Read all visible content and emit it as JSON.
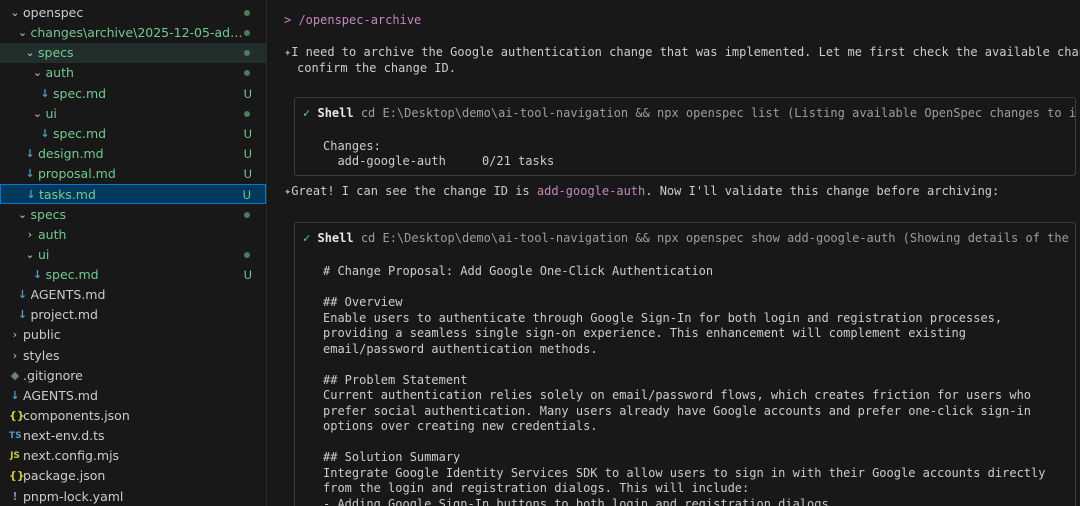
{
  "colors": {
    "added": "#73c991",
    "selection": "#04395e",
    "accent": "#c586c0",
    "background": "#181818"
  },
  "explorer": {
    "items": [
      {
        "label": "openspec",
        "icon": "chevron-down-icon",
        "badge": "",
        "dot": true
      },
      {
        "label": "changes\\archive\\2025-12-05-add-g...",
        "icon": "chevron-down-icon",
        "badge": "",
        "dot": true,
        "green": true
      },
      {
        "label": "specs",
        "icon": "chevron-down-icon",
        "badge": "",
        "dot": true,
        "green": true,
        "hl": true
      },
      {
        "label": "auth",
        "icon": "chevron-down-icon",
        "badge": "",
        "dot": true,
        "green": true
      },
      {
        "label": "spec.md",
        "icon": "markdown-icon",
        "badge": "U",
        "green": true
      },
      {
        "label": "ui",
        "icon": "chevron-down-icon",
        "badge": "",
        "dot": true,
        "green": true
      },
      {
        "label": "spec.md",
        "icon": "markdown-icon",
        "badge": "U",
        "green": true
      },
      {
        "label": "design.md",
        "icon": "markdown-icon",
        "badge": "U",
        "green": true
      },
      {
        "label": "proposal.md",
        "icon": "markdown-icon",
        "badge": "U",
        "green": true
      },
      {
        "label": "tasks.md",
        "icon": "markdown-icon",
        "badge": "U",
        "green": true,
        "selected": true
      },
      {
        "label": "specs",
        "icon": "chevron-down-icon",
        "badge": "",
        "dot": true,
        "green": true
      },
      {
        "label": "auth",
        "icon": "chevron-right-icon",
        "badge": "",
        "green": true
      },
      {
        "label": "ui",
        "icon": "chevron-down-icon",
        "badge": "",
        "dot": true,
        "green": true
      },
      {
        "label": "spec.md",
        "icon": "markdown-icon",
        "badge": "U",
        "green": true
      },
      {
        "label": "AGENTS.md",
        "icon": "markdown-icon",
        "badge": ""
      },
      {
        "label": "project.md",
        "icon": "markdown-icon",
        "badge": ""
      },
      {
        "label": "public",
        "icon": "chevron-right-icon",
        "badge": ""
      },
      {
        "label": "styles",
        "icon": "chevron-right-icon",
        "badge": ""
      },
      {
        "label": ".gitignore",
        "icon": "git-icon",
        "badge": ""
      },
      {
        "label": "AGENTS.md",
        "icon": "markdown-icon",
        "badge": ""
      },
      {
        "label": "components.json",
        "icon": "json-icon",
        "badge": ""
      },
      {
        "label": "next-env.d.ts",
        "icon": "typescript-icon",
        "badge": ""
      },
      {
        "label": "next.config.mjs",
        "icon": "javascript-icon",
        "badge": ""
      },
      {
        "label": "package.json",
        "icon": "json-icon",
        "badge": ""
      },
      {
        "label": "pnpm-lock.yaml",
        "icon": "yaml-icon",
        "badge": ""
      }
    ]
  },
  "chat": {
    "command": "> /openspec-archive",
    "msg1": [
      "I need to archive the Google authentication change that was implemented. Let me first check the available changes to",
      "confirm the change ID."
    ],
    "shell1": {
      "label": "Shell",
      "cmd": "cd E:\\Desktop\\demo\\ai-tool-navigation && npx openspec list (Listing available OpenSpec changes to identify th...",
      "output": [
        "Changes:",
        "  add-google-auth     0/21 tasks"
      ]
    },
    "msg2": {
      "before": "Great! I can see the change ID is ",
      "highlight": "add-google-auth",
      "after": ". Now I'll validate this change before archiving:"
    },
    "shell2": {
      "label": "Shell",
      "cmd": "cd E:\\Desktop\\demo\\ai-tool-navigation && npx openspec show add-google-auth (Showing details of the Google aut...",
      "output": [
        "# Change Proposal: Add Google One-Click Authentication",
        "",
        "## Overview",
        "Enable users to authenticate through Google Sign-In for both login and registration processes,",
        "providing a seamless single sign-on experience. This enhancement will complement existing",
        "email/password authentication methods.",
        "",
        "## Problem Statement",
        "Current authentication relies solely on email/password flows, which creates friction for users who",
        "prefer social authentication. Many users already have Google accounts and prefer one-click sign-in",
        "options over creating new credentials.",
        "",
        "## Solution Summary",
        "Integrate Google Identity Services SDK to allow users to sign in with their Google accounts directly",
        "from the login and registration dialogs. This will include:",
        "- Adding Google Sign-In buttons to both login and registration dialogs"
      ]
    }
  }
}
